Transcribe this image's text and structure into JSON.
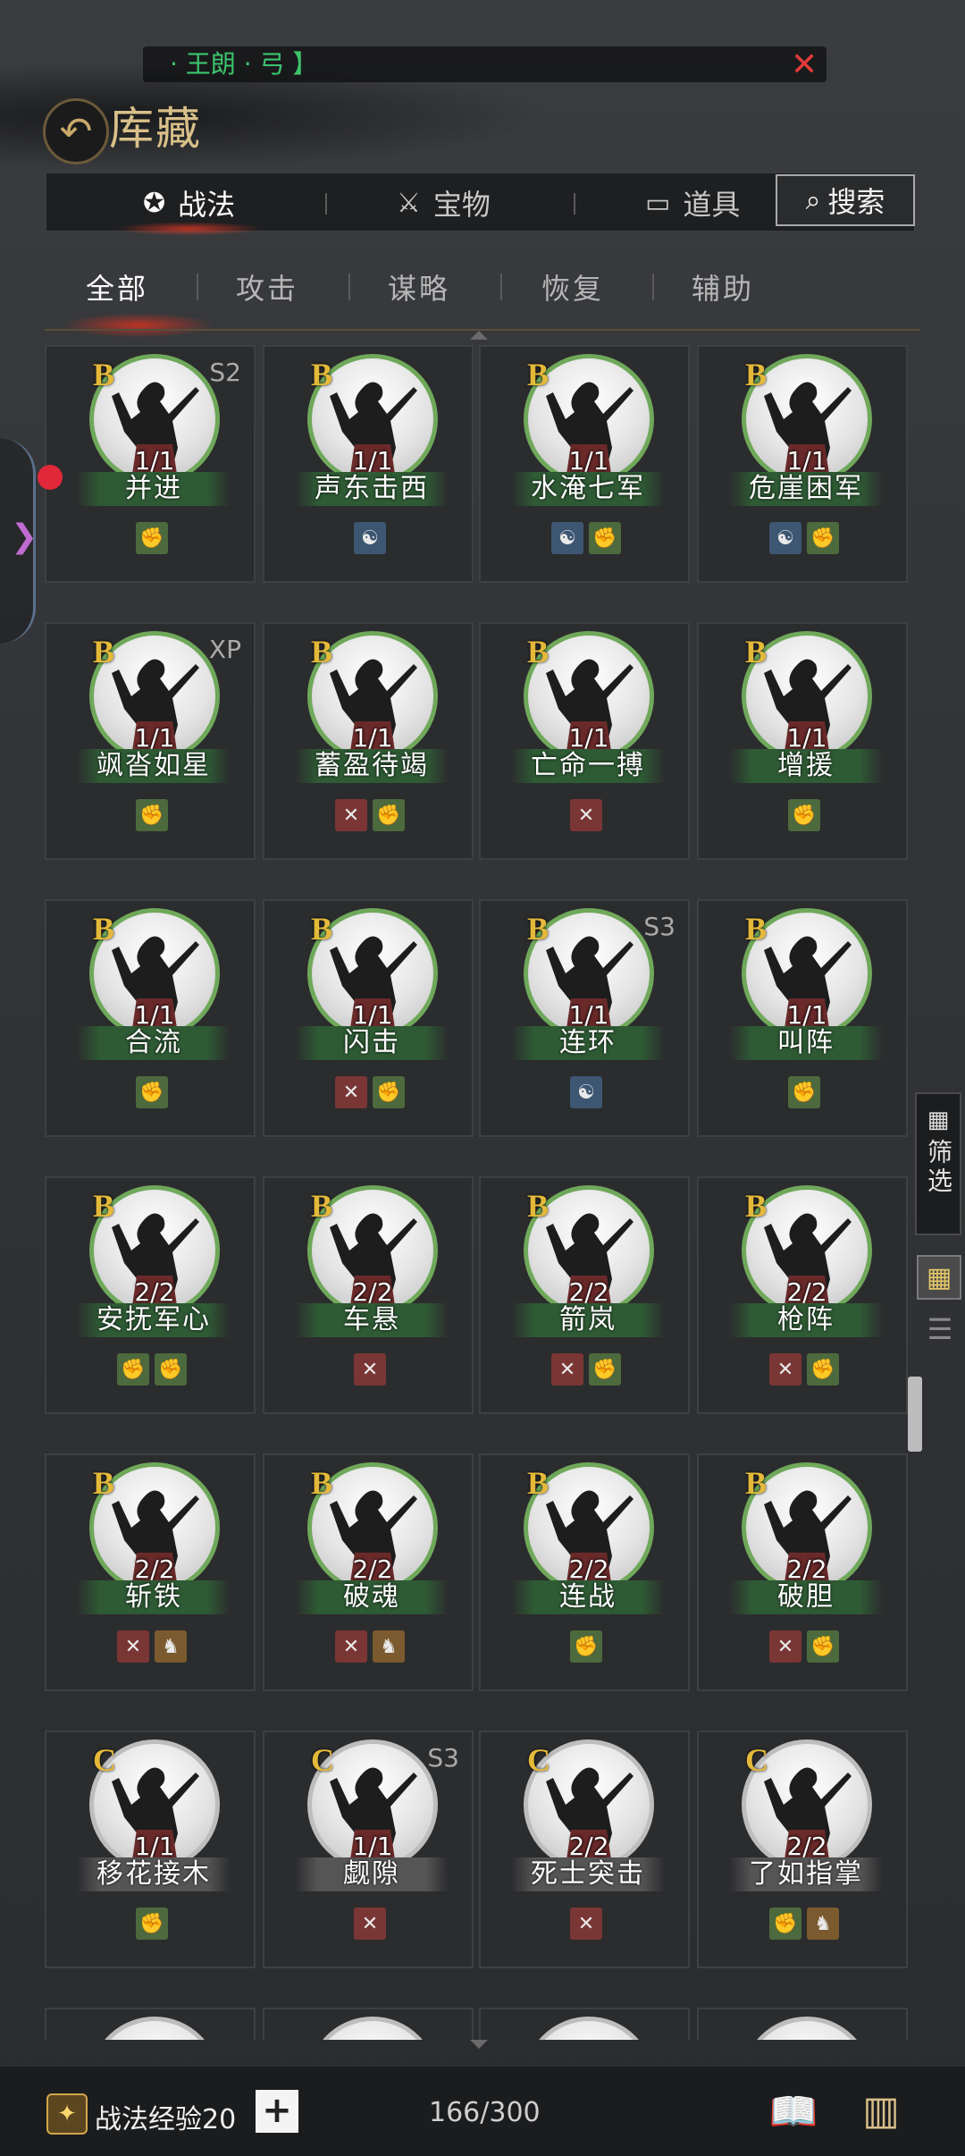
{
  "header": {
    "back_icon": "back-arrow-icon",
    "title": "库藏",
    "search_chip_text": "· 王朗 · 弓 】",
    "search_chip_close": "✕"
  },
  "main_tabs": [
    {
      "label": "战法",
      "icon": "scroll-icon",
      "active": true
    },
    {
      "label": "宝物",
      "icon": "weapon-icon",
      "active": false
    },
    {
      "label": "道具",
      "icon": "box-icon",
      "active": false
    }
  ],
  "search_button": {
    "label": "搜索",
    "icon": "magnifier-icon"
  },
  "sub_tabs": [
    {
      "label": "全部",
      "active": true
    },
    {
      "label": "攻击",
      "active": false
    },
    {
      "label": "谋略",
      "active": false
    },
    {
      "label": "恢复",
      "active": false
    },
    {
      "label": "辅助",
      "active": false
    }
  ],
  "cards": [
    [
      {
        "grade": "B",
        "tag": "S2",
        "count": "1/1",
        "name": "并进",
        "icons": [
          "green"
        ]
      },
      {
        "grade": "B",
        "tag": "",
        "count": "1/1",
        "name": "声东击西",
        "icons": [
          "blue"
        ]
      },
      {
        "grade": "B",
        "tag": "",
        "count": "1/1",
        "name": "水淹七军",
        "icons": [
          "blue",
          "green"
        ]
      },
      {
        "grade": "B",
        "tag": "",
        "count": "1/1",
        "name": "危崖困军",
        "icons": [
          "blue",
          "green"
        ]
      }
    ],
    [
      {
        "grade": "B",
        "tag": "XP",
        "count": "1/1",
        "name": "飒沓如星",
        "icons": [
          "green"
        ]
      },
      {
        "grade": "B",
        "tag": "",
        "count": "1/1",
        "name": "蓄盈待竭",
        "icons": [
          "red",
          "green"
        ]
      },
      {
        "grade": "B",
        "tag": "",
        "count": "1/1",
        "name": "亡命一搏",
        "icons": [
          "red"
        ]
      },
      {
        "grade": "B",
        "tag": "",
        "count": "1/1",
        "name": "增援",
        "icons": [
          "green"
        ]
      }
    ],
    [
      {
        "grade": "B",
        "tag": "",
        "count": "1/1",
        "name": "合流",
        "icons": [
          "green"
        ]
      },
      {
        "grade": "B",
        "tag": "",
        "count": "1/1",
        "name": "闪击",
        "icons": [
          "red",
          "green"
        ]
      },
      {
        "grade": "B",
        "tag": "S3",
        "count": "1/1",
        "name": "连环",
        "icons": [
          "blue"
        ]
      },
      {
        "grade": "B",
        "tag": "",
        "count": "1/1",
        "name": "叫阵",
        "icons": [
          "green"
        ]
      }
    ],
    [
      {
        "grade": "B",
        "tag": "",
        "count": "2/2",
        "name": "安抚军心",
        "icons": [
          "green",
          "green"
        ]
      },
      {
        "grade": "B",
        "tag": "",
        "count": "2/2",
        "name": "车悬",
        "icons": [
          "red"
        ]
      },
      {
        "grade": "B",
        "tag": "",
        "count": "2/2",
        "name": "箭岚",
        "icons": [
          "red",
          "green"
        ]
      },
      {
        "grade": "B",
        "tag": "",
        "count": "2/2",
        "name": "枪阵",
        "icons": [
          "red",
          "green"
        ]
      }
    ],
    [
      {
        "grade": "B",
        "tag": "",
        "count": "2/2",
        "name": "斩铁",
        "icons": [
          "red",
          "brown"
        ]
      },
      {
        "grade": "B",
        "tag": "",
        "count": "2/2",
        "name": "破魂",
        "icons": [
          "red",
          "brown"
        ]
      },
      {
        "grade": "B",
        "tag": "",
        "count": "2/2",
        "name": "连战",
        "icons": [
          "green"
        ]
      },
      {
        "grade": "B",
        "tag": "",
        "count": "2/2",
        "name": "破胆",
        "icons": [
          "red",
          "green"
        ]
      }
    ],
    [
      {
        "grade": "C",
        "tag": "",
        "count": "1/1",
        "name": "移花接木",
        "icons": [
          "green"
        ]
      },
      {
        "grade": "C",
        "tag": "S3",
        "count": "1/1",
        "name": "觑隙",
        "icons": [
          "red"
        ]
      },
      {
        "grade": "C",
        "tag": "",
        "count": "2/2",
        "name": "死士突击",
        "icons": [
          "red"
        ]
      },
      {
        "grade": "C",
        "tag": "",
        "count": "2/2",
        "name": "了如指掌",
        "icons": [
          "green",
          "brown"
        ]
      }
    ]
  ],
  "side": {
    "filter_label": "筛选",
    "filter_icon": "grid-icon",
    "grid_view_icon": "grid-view-icon",
    "list_view_icon": "list-view-icon"
  },
  "bottom": {
    "exp_label": "战法经验20",
    "plus": "+",
    "capacity": "166/300",
    "icon_1": "book-icon",
    "icon_2": "scroll-rack-icon"
  },
  "colors": {
    "accent_gold": "#d9c08a",
    "grade_gold": "#e4b93a",
    "frame_green": "#6fa85a",
    "frame_grey": "#bdbdbd"
  }
}
